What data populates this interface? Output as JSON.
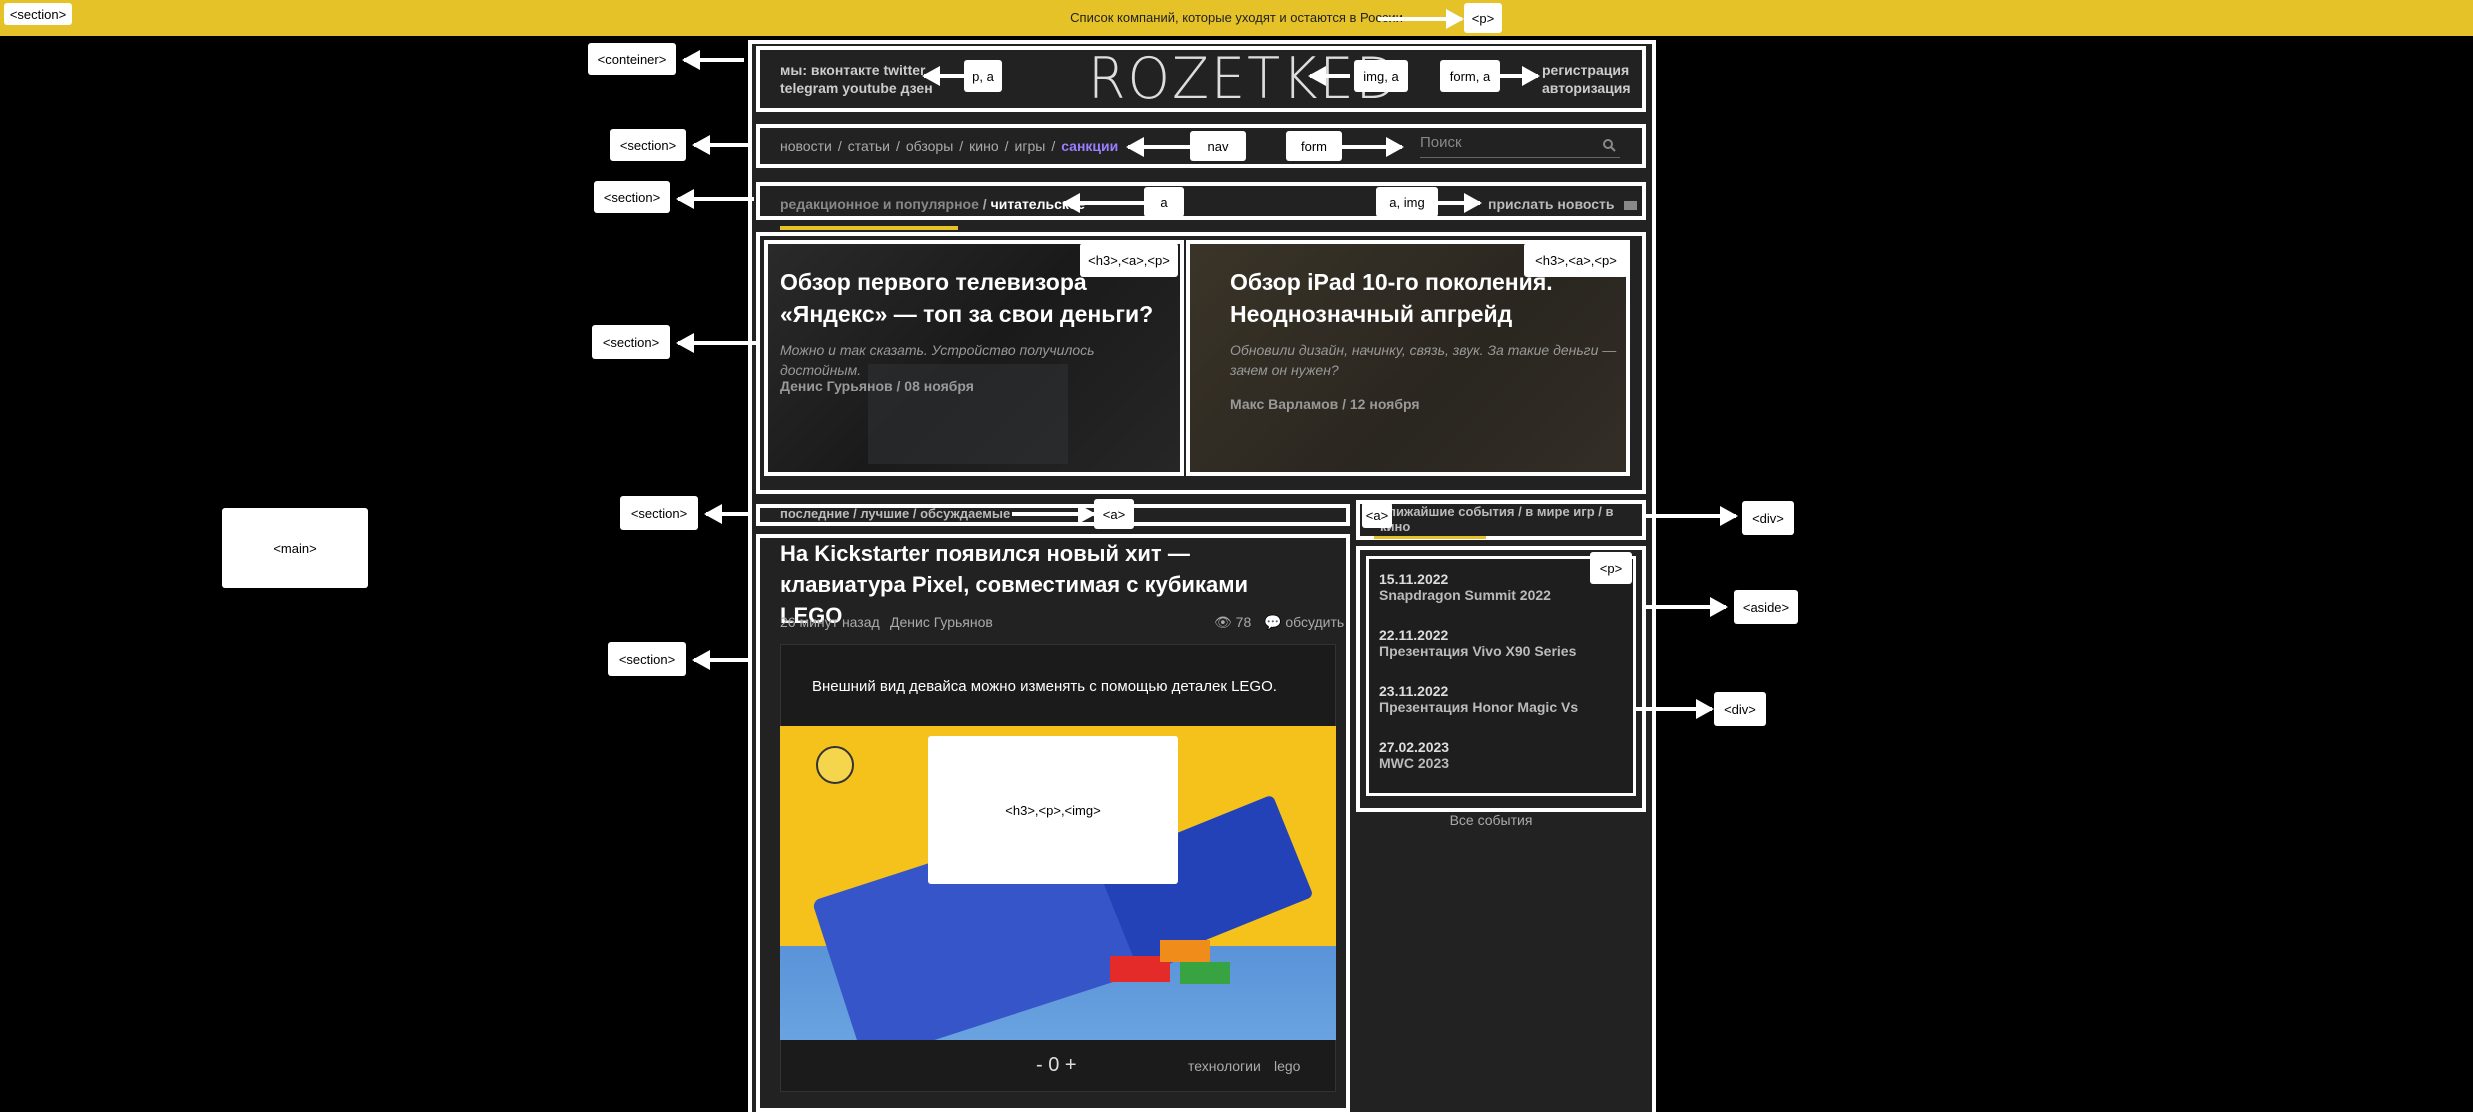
{
  "annotations": {
    "section_top": "<section>",
    "p_top": "<p>",
    "container": "<conteiner>",
    "p_a": "p, a",
    "img_a": "img, a",
    "form_a": "form, a",
    "section_nav": "<section>",
    "nav": "nav",
    "form": "form",
    "section_tabs": "<section>",
    "a_tabs": "a",
    "a_img": "a, img",
    "section_cards": "<section>",
    "card1_tags": "<h3>,<a>,<p>",
    "card2_tags": "<h3>,<a>,<p>",
    "section_feed_tabs": "<section>",
    "a_feed_tabs": "<a>",
    "a_events_tabs": "<a>",
    "div_events_tabs": "<div>",
    "main": "<main>",
    "section_article": "<section>",
    "h3_p_img": "<h3>,<p>,<img>",
    "p_events": "<p>",
    "aside": "<aside>",
    "div_events": "<div>"
  },
  "topbar": {
    "text": "Список компаний, которые уходят и остаются в России"
  },
  "header": {
    "social_line1": "мы: вконтакте twitter",
    "social_line2": "telegram youtube дзен",
    "logo": "ROZETKED",
    "register": "регистрация",
    "login": "авторизация"
  },
  "nav": {
    "items": [
      "новости",
      "статьи",
      "обзоры",
      "кино",
      "игры"
    ],
    "separator": "/",
    "active": "санкции"
  },
  "search": {
    "placeholder": "Поиск"
  },
  "tabs": {
    "editorial": "редакционное и популярное",
    "separator": "/",
    "reader": "читательское",
    "send_news": "прислать новость"
  },
  "cards": [
    {
      "title": "Обзор первого телевизора «Яндекс» — топ за свои деньги?",
      "desc": "Можно и так сказать. Устройство получилось достойным.",
      "meta": "Денис Гурьянов / 08 ноября"
    },
    {
      "title": "Обзор iPad 10-го поколения. Неоднозначный апгрейд",
      "desc": "Обновили дизайн, начинку, связь, звук. За такие деньги — зачем он нужен?",
      "meta": "Макс Варламов / 12 ноября"
    }
  ],
  "feed_tabs": {
    "text": "последние / лучшие / обсуждаемые"
  },
  "events_tabs": {
    "text": "ближайшие события / в мире игр / в кино"
  },
  "article": {
    "title": "На Kickstarter появился новый хит — клавиатура Pixel, совместимая с кубиками LEGO",
    "time": "26 минут назад",
    "author": "Денис Гурьянов",
    "views": "78",
    "discuss": "обсудить",
    "lead": "Внешний вид девайса можно изменять с помощью деталек LEGO.",
    "votes": "- 0 +",
    "tags": [
      "технологии",
      "lego"
    ]
  },
  "events": {
    "items": [
      {
        "date": "15.11.2022",
        "name": "Snapdragon Summit 2022"
      },
      {
        "date": "22.11.2022",
        "name": "Презентация Vivo X90 Series"
      },
      {
        "date": "23.11.2022",
        "name": "Презентация Honor Magic Vs"
      },
      {
        "date": "27.02.2023",
        "name": "MWC 2023"
      }
    ],
    "all": "Все события"
  },
  "colors": {
    "topbar": "#e5c227",
    "page": "#222222",
    "accent": "#9b7dff",
    "underline": "#e5c227"
  }
}
